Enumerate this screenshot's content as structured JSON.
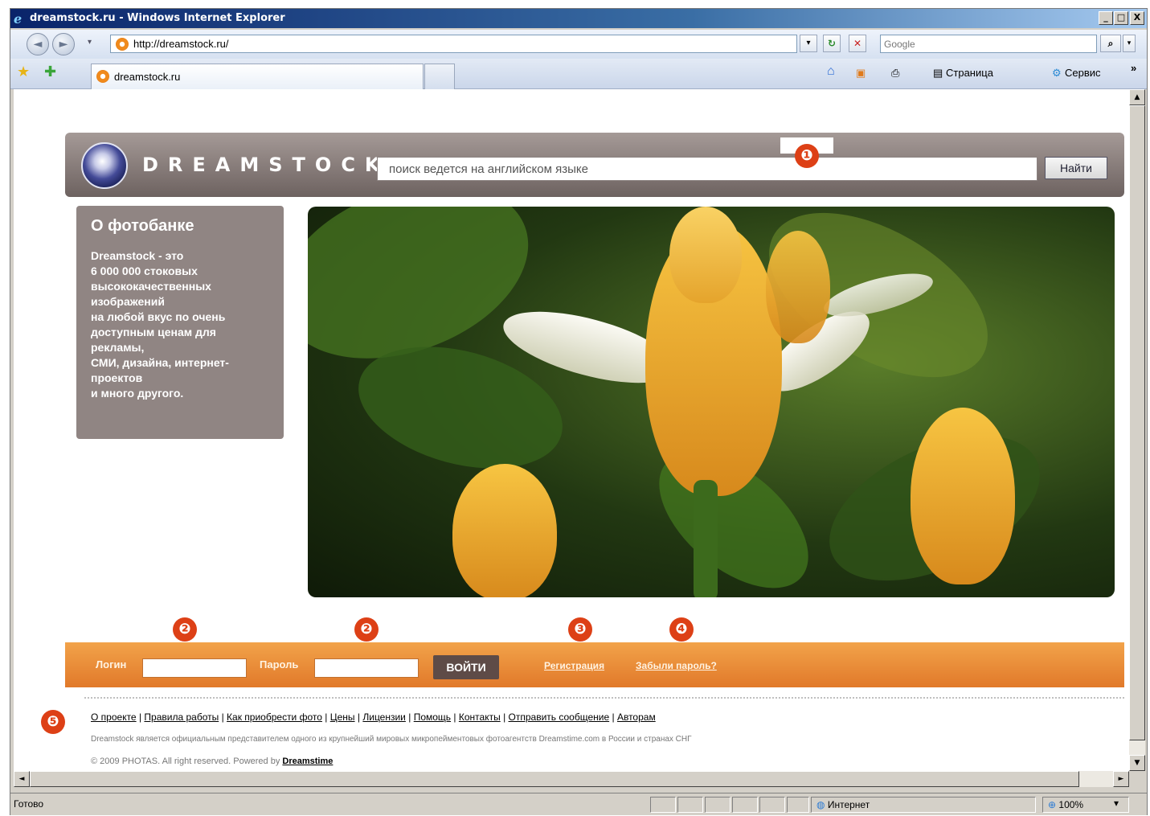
{
  "window": {
    "title": "dreamstock.ru - Windows Internet Explorer",
    "min": "_",
    "max": "□",
    "close": "X"
  },
  "browser": {
    "back_glyph": "◄",
    "forward_glyph": "►",
    "address": "http://dreamstock.ru/",
    "go_dropdown": "▾",
    "refresh_glyph": "↻",
    "stop_glyph": "✕",
    "search_placeholder": "Google",
    "search_btn_glyph": "⌕",
    "tab_title": "dreamstock.ru",
    "tools": {
      "page": "Страница",
      "service": "Сервис",
      "more": "»"
    }
  },
  "page": {
    "logo_text": "DREAMSTOCK",
    "search_placeholder": "поиск ведется на английском языке",
    "search_button": "Найти",
    "about_title": "О фотобанке",
    "about_text": "Dreamstock - это\n6 000 000 стоковых\nвысококачественных\nизображений\nна любой вкус по очень\nдоступным ценам для\nрекламы,\nСМИ, дизайна, интернет-\nпроектов\nи много другого.",
    "login_label": "Логин",
    "password_label": "Пароль",
    "login_button": "ВОЙТИ",
    "register_link": "Регистрация",
    "forgot_link": "Забыли пароль?",
    "footer": {
      "links": [
        "О проекте",
        "Правила работы",
        "Как приобрести фото",
        "Цены",
        "Лицензии",
        "Помощь",
        "Контакты",
        "Отправить сообщение",
        "Авторам"
      ],
      "separator": "|",
      "description": "Dreamstock является официальным представителем одного из крупнейший мировых микропейментовых фотоагентств Dreamstime.com в России и странах СНГ",
      "copyright": "© 2009 PHOTAS. All right reserved. Powered by",
      "powered_link": "Dreamstime"
    }
  },
  "markers": [
    "❶",
    "❷",
    "❷",
    "❸",
    "❹",
    "❺"
  ],
  "status": {
    "text": "Готово",
    "zone": "Интернет",
    "zoom": "100%"
  },
  "colors": {
    "header_top": "#a59a97",
    "header_bottom": "#6d6260",
    "about_bg": "#908583",
    "login_bar": "#e1792a",
    "login_button": "#5e4b47",
    "marker": "#dd4016"
  }
}
